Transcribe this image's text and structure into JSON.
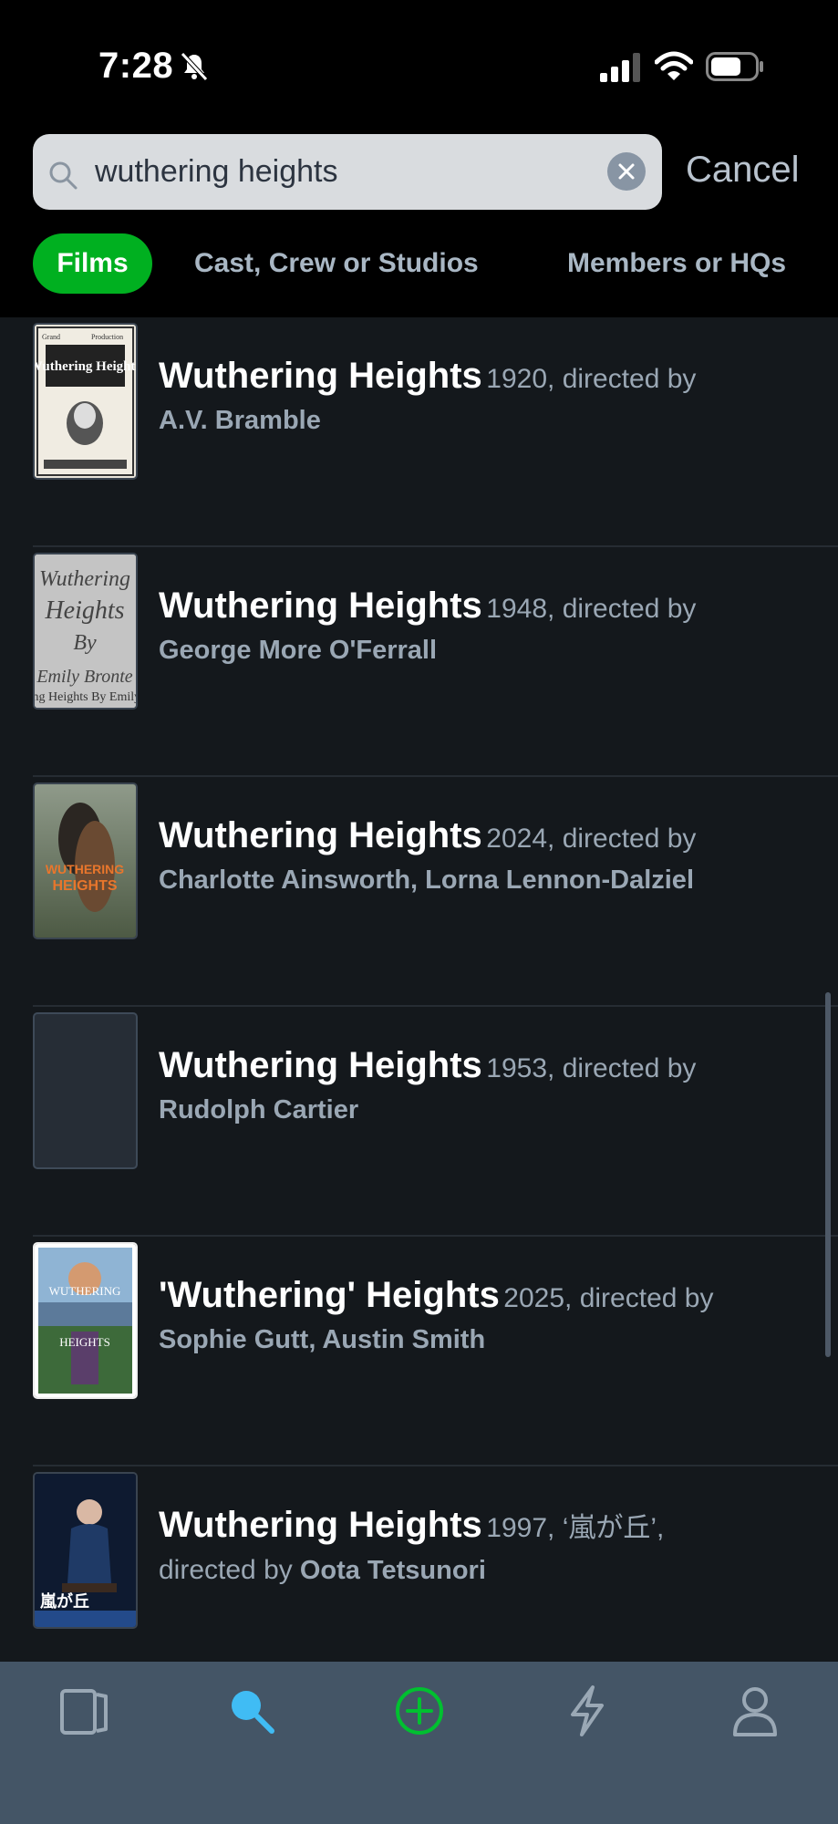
{
  "status_bar": {
    "time": "7:28"
  },
  "search": {
    "query": "wuthering heights",
    "cancel_label": "Cancel"
  },
  "tabs": [
    {
      "label": "Films"
    },
    {
      "label": "Cast, Crew or Studios"
    },
    {
      "label": "Members or HQs"
    }
  ],
  "results": [
    {
      "title": "Wuthering Heights",
      "year": "1920",
      "alt_title": "",
      "directed_by": "directed by",
      "directors": "A.V. Bramble"
    },
    {
      "title": "Wuthering Heights",
      "year": "1948",
      "alt_title": "",
      "directed_by": "directed by",
      "directors": "George More O'Ferrall"
    },
    {
      "title": "Wuthering Heights",
      "year": "2024",
      "alt_title": "",
      "directed_by": "directed by",
      "directors": "Charlotte Ainsworth, Lorna Lennon-Dalziel"
    },
    {
      "title": "Wuthering Heights",
      "year": "1953",
      "alt_title": "",
      "directed_by": "directed by",
      "directors": "Rudolph Cartier"
    },
    {
      "title": "'Wuthering' Heights",
      "year": "2025",
      "alt_title": "",
      "directed_by": "directed by",
      "directors": "Sophie Gutt, Austin Smith"
    },
    {
      "title": "Wuthering Heights",
      "year": "1997",
      "alt_title": "‘嵐が丘’",
      "directed_by": "directed by",
      "directors": "Oota Tetsunori"
    }
  ],
  "posters": {
    "p1": {
      "line_a": "Grand",
      "line_b": "Production",
      "title": "Wuthering Heights"
    },
    "p2": {
      "text": "Wuthering Heights By Emily Bronte"
    },
    "p3": {
      "text": "WUTHERING HEIGHTS"
    },
    "p5": {
      "top": "WUTHERING",
      "bottom": "HEIGHTS"
    },
    "p6": {
      "text": "嵐が丘"
    }
  },
  "bottom_nav": [
    {
      "icon": "films-icon"
    },
    {
      "icon": "search-icon",
      "active": true
    },
    {
      "icon": "add-icon"
    },
    {
      "icon": "activity-icon"
    },
    {
      "icon": "profile-icon"
    }
  ],
  "colors": {
    "accent_green": "#00b020",
    "active_blue": "#40bcf4",
    "nav_bg": "#445566",
    "bg": "#14181c"
  }
}
